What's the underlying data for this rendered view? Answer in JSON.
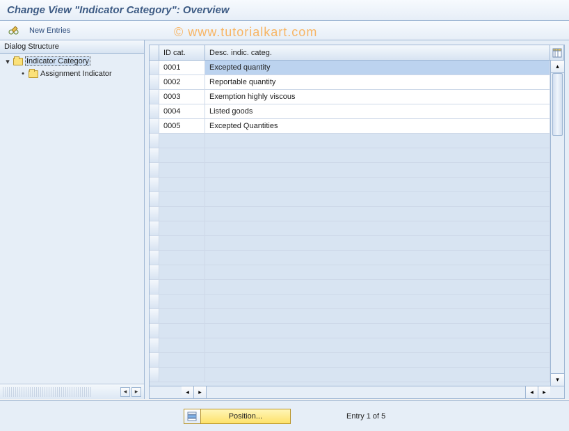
{
  "title": "Change View \"Indicator Category\": Overview",
  "toolbar": {
    "new_entries_label": "New Entries"
  },
  "sidebar": {
    "header": "Dialog Structure",
    "nodes": [
      {
        "label": "Indicator Category",
        "expanded": true,
        "active": true,
        "level": 1
      },
      {
        "label": "Assignment Indicator",
        "expanded": false,
        "active": false,
        "level": 2
      }
    ]
  },
  "table": {
    "columns": {
      "id": "ID cat.",
      "desc": "Desc. indic. categ."
    },
    "rows": [
      {
        "id": "0001",
        "desc": "Excepted quantity",
        "selected": true
      },
      {
        "id": "0002",
        "desc": "Reportable quantity",
        "selected": false
      },
      {
        "id": "0003",
        "desc": "Exemption highly viscous",
        "selected": false
      },
      {
        "id": "0004",
        "desc": "Listed goods",
        "selected": false
      },
      {
        "id": "0005",
        "desc": "Excepted Quantities",
        "selected": false
      }
    ],
    "empty_row_count": 17
  },
  "footer": {
    "position_label": "Position...",
    "entry_text": "Entry 1 of 5"
  },
  "watermark": "© www.tutorialkart.com"
}
